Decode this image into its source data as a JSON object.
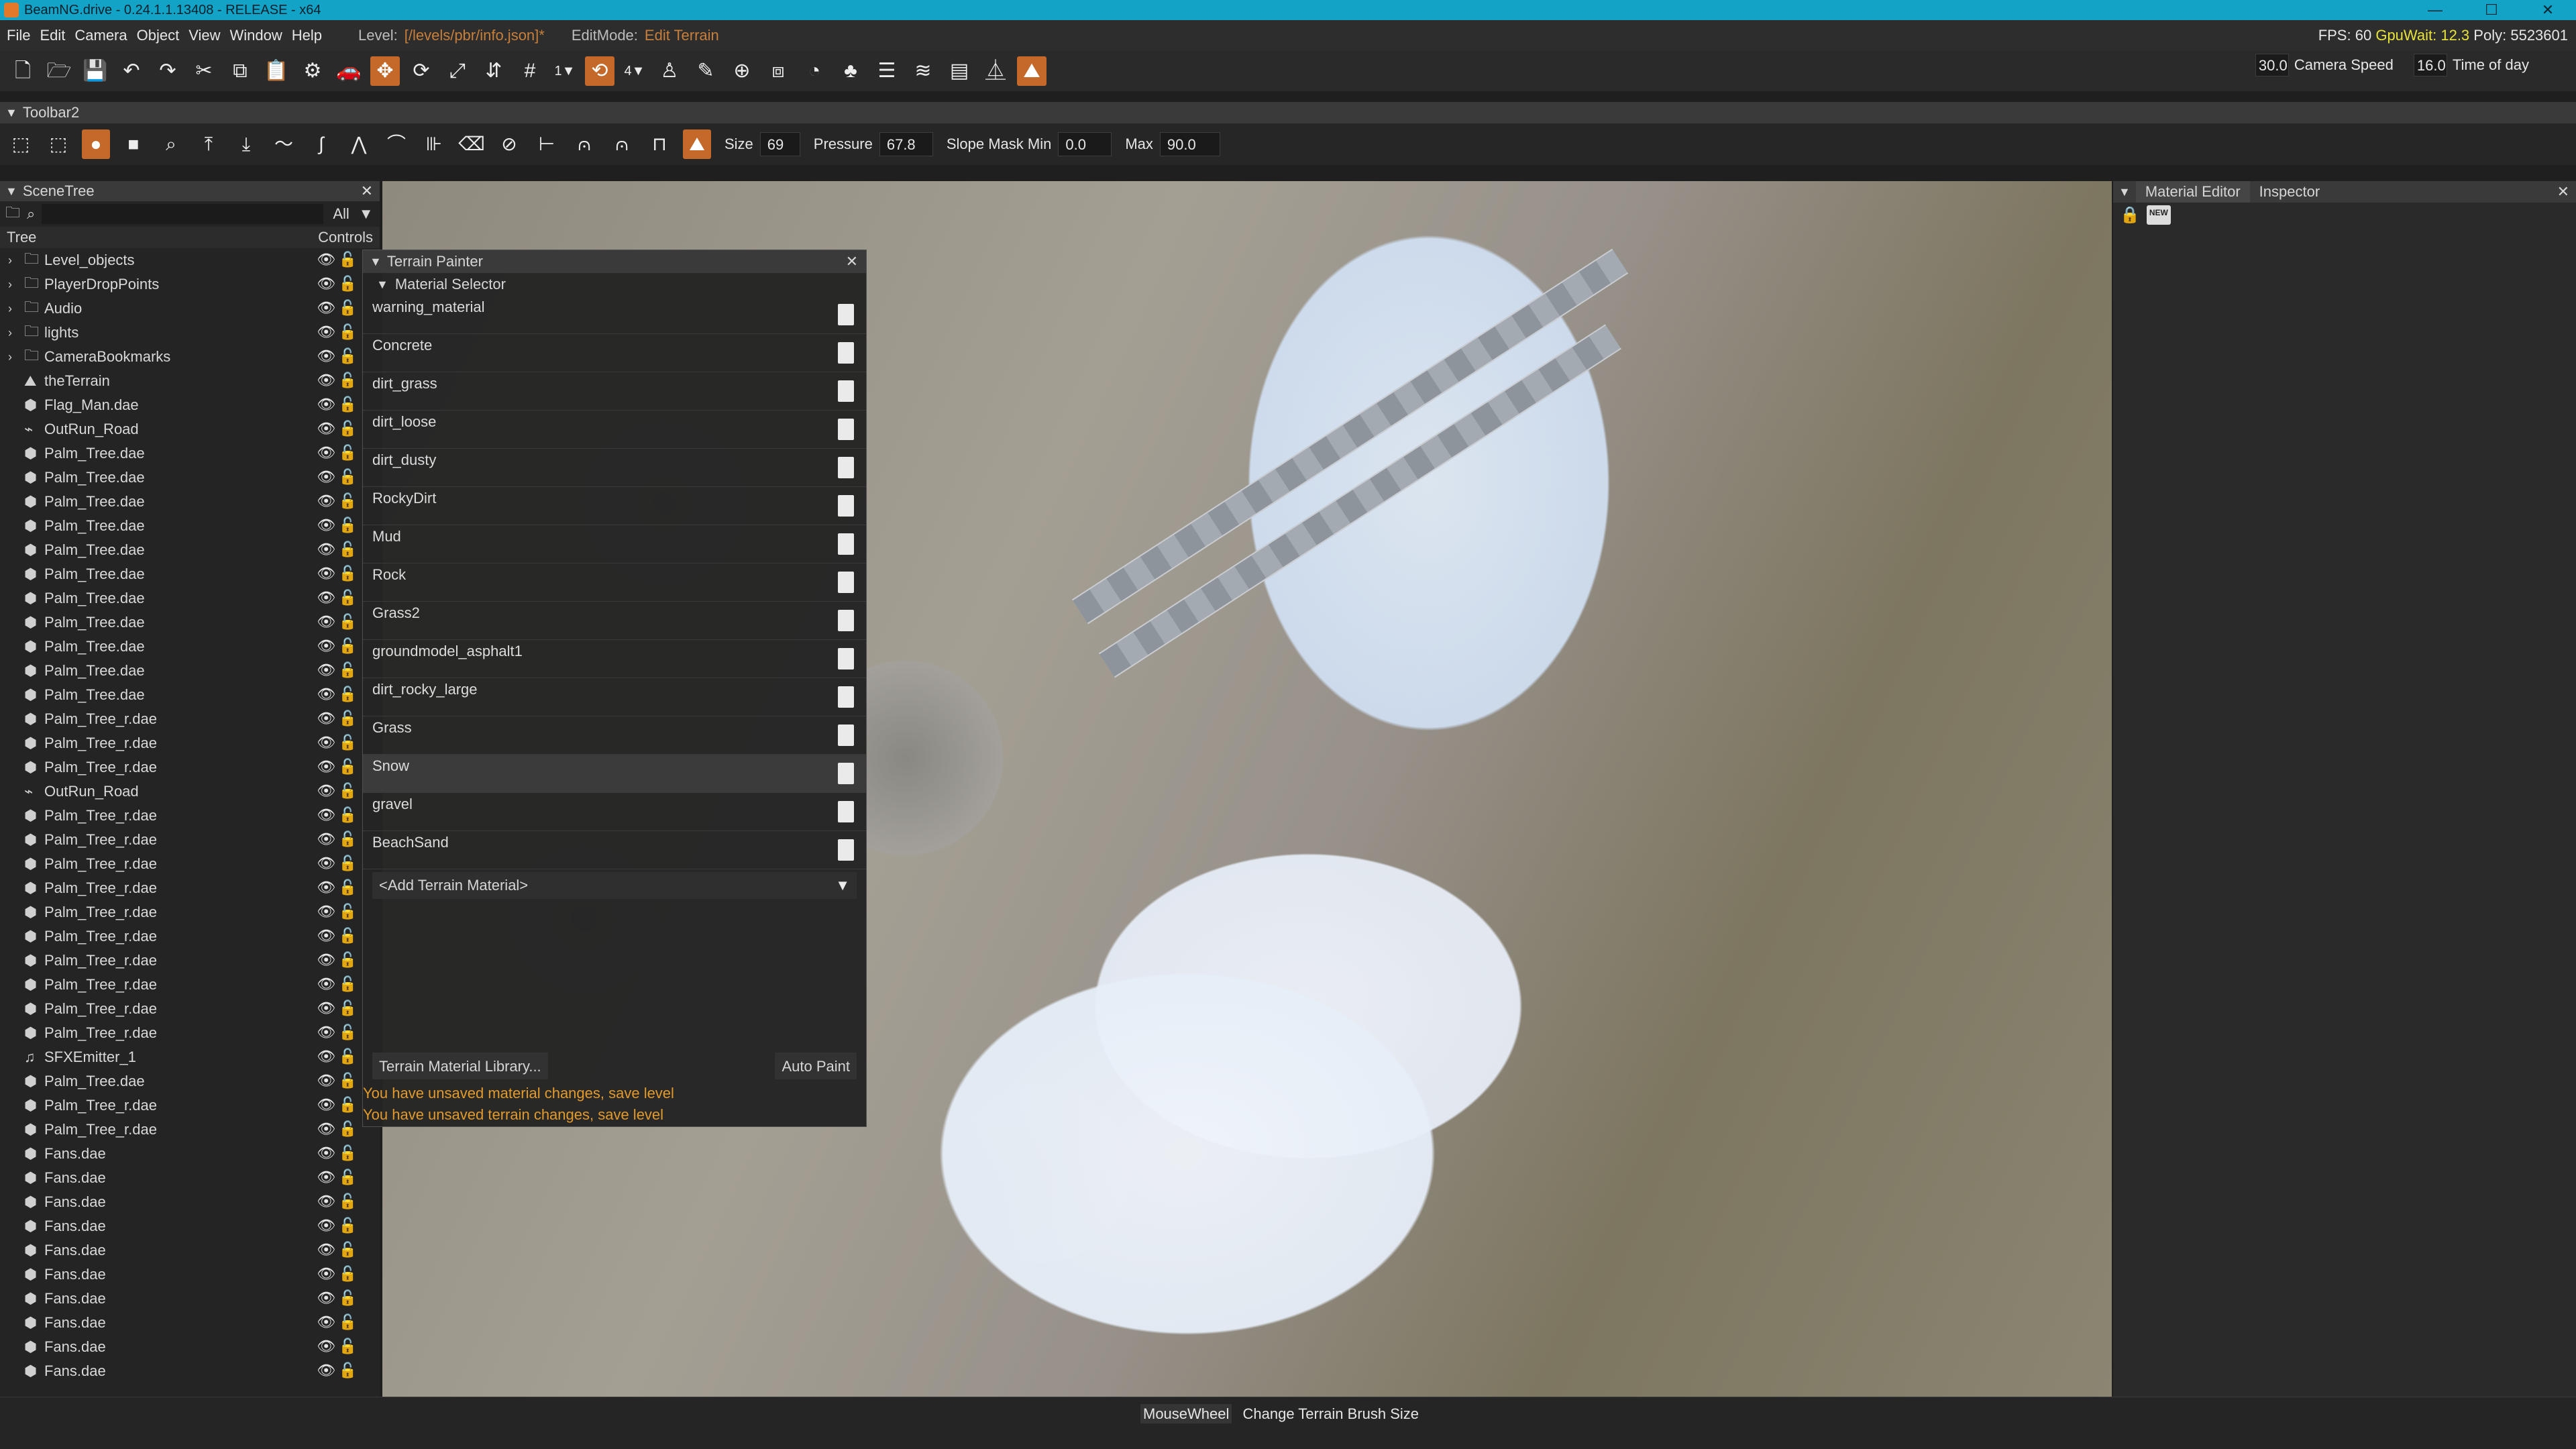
{
  "window": {
    "title": "BeamNG.drive - 0.24.1.1.13408 - RELEASE - x64",
    "controls": [
      "—",
      "☐",
      "✕"
    ]
  },
  "menu": {
    "items": [
      "File",
      "Edit",
      "Camera",
      "Object",
      "View",
      "Window",
      "Help"
    ],
    "level_label": "Level:",
    "level_path": "[/levels/pbr/info.json]*",
    "editmode_label": "EditMode:",
    "editmode_value": "Edit Terrain",
    "stats": {
      "fps_label": "FPS:",
      "fps": "60",
      "gpu_label": "GpuWait:",
      "gpu": "12.3",
      "poly_label": "Poly:",
      "poly": "5523601"
    }
  },
  "camera": {
    "speed": "30.0",
    "speed_label": "Camera Speed",
    "time": "16.0",
    "time_label": "Time of day"
  },
  "toolbar1": {
    "icons": [
      "new-file-icon",
      "open-folder-icon",
      "save-icon",
      "undo-icon",
      "redo-icon",
      "cut-icon",
      "copy-icon",
      "paste-icon",
      "settings-gear-icon",
      "vehicle-icon",
      "move-tool-icon",
      "rotate-tool-icon",
      "scale-tool-icon",
      "align-icon",
      "grid-snap-icon",
      "snap-1-icon",
      "rotate-snap-icon",
      "snap-4-icon",
      "figure-icon",
      "pencil-icon",
      "add-circle-icon",
      "camera-path-icon",
      "pie-icon",
      "forest-icon",
      "stack-icon",
      "river-icon",
      "mesh-road-icon",
      "road-icon",
      "terrain-paint-icon"
    ],
    "snap_values": [
      "1▼",
      "4▼"
    ]
  },
  "toolbar2": {
    "title": "Toolbar2",
    "size_label": "Size",
    "size_value": "69",
    "pressure_label": "Pressure",
    "pressure_value": "67.8",
    "slope_min_label": "Slope Mask Min",
    "slope_min_value": "0.0",
    "max_label": "Max",
    "max_value": "90.0"
  },
  "scenetree": {
    "title": "SceneTree",
    "filter": "All",
    "col_tree": "Tree",
    "col_controls": "Controls",
    "rows": [
      {
        "name": "Level_objects",
        "type": "folder"
      },
      {
        "name": "PlayerDropPoints",
        "type": "folder"
      },
      {
        "name": "Audio",
        "type": "folder"
      },
      {
        "name": "lights",
        "type": "folder"
      },
      {
        "name": "CameraBookmarks",
        "type": "folder"
      },
      {
        "name": "theTerrain",
        "type": "terrain"
      },
      {
        "name": "Flag_Man.dae",
        "type": "mesh"
      },
      {
        "name": "OutRun_Road",
        "type": "road"
      },
      {
        "name": "Palm_Tree.dae",
        "type": "mesh"
      },
      {
        "name": "Palm_Tree.dae",
        "type": "mesh"
      },
      {
        "name": "Palm_Tree.dae",
        "type": "mesh"
      },
      {
        "name": "Palm_Tree.dae",
        "type": "mesh"
      },
      {
        "name": "Palm_Tree.dae",
        "type": "mesh"
      },
      {
        "name": "Palm_Tree.dae",
        "type": "mesh"
      },
      {
        "name": "Palm_Tree.dae",
        "type": "mesh"
      },
      {
        "name": "Palm_Tree.dae",
        "type": "mesh"
      },
      {
        "name": "Palm_Tree.dae",
        "type": "mesh"
      },
      {
        "name": "Palm_Tree.dae",
        "type": "mesh"
      },
      {
        "name": "Palm_Tree.dae",
        "type": "mesh"
      },
      {
        "name": "Palm_Tree_r.dae",
        "type": "mesh"
      },
      {
        "name": "Palm_Tree_r.dae",
        "type": "mesh"
      },
      {
        "name": "Palm_Tree_r.dae",
        "type": "mesh"
      },
      {
        "name": "OutRun_Road",
        "type": "road"
      },
      {
        "name": "Palm_Tree_r.dae",
        "type": "mesh"
      },
      {
        "name": "Palm_Tree_r.dae",
        "type": "mesh"
      },
      {
        "name": "Palm_Tree_r.dae",
        "type": "mesh"
      },
      {
        "name": "Palm_Tree_r.dae",
        "type": "mesh"
      },
      {
        "name": "Palm_Tree_r.dae",
        "type": "mesh"
      },
      {
        "name": "Palm_Tree_r.dae",
        "type": "mesh"
      },
      {
        "name": "Palm_Tree_r.dae",
        "type": "mesh"
      },
      {
        "name": "Palm_Tree_r.dae",
        "type": "mesh"
      },
      {
        "name": "Palm_Tree_r.dae",
        "type": "mesh"
      },
      {
        "name": "Palm_Tree_r.dae",
        "type": "mesh"
      },
      {
        "name": "SFXEmitter_1",
        "type": "sound"
      },
      {
        "name": "Palm_Tree.dae",
        "type": "mesh"
      },
      {
        "name": "Palm_Tree_r.dae",
        "type": "mesh"
      },
      {
        "name": "Palm_Tree_r.dae",
        "type": "mesh"
      },
      {
        "name": "Fans.dae",
        "type": "mesh"
      },
      {
        "name": "Fans.dae",
        "type": "mesh"
      },
      {
        "name": "Fans.dae",
        "type": "mesh"
      },
      {
        "name": "Fans.dae",
        "type": "mesh"
      },
      {
        "name": "Fans.dae",
        "type": "mesh"
      },
      {
        "name": "Fans.dae",
        "type": "mesh"
      },
      {
        "name": "Fans.dae",
        "type": "mesh"
      },
      {
        "name": "Fans.dae",
        "type": "mesh"
      },
      {
        "name": "Fans.dae",
        "type": "mesh"
      },
      {
        "name": "Fans.dae",
        "type": "mesh"
      }
    ]
  },
  "terrain_painter": {
    "title": "Terrain Painter",
    "section": "Material Selector",
    "materials": [
      "warning_material",
      "Concrete",
      "dirt_grass",
      "dirt_loose",
      "dirt_dusty",
      "RockyDirt",
      "Mud",
      "Rock",
      "Grass2",
      "groundmodel_asphalt1",
      "dirt_rocky_large",
      "Grass",
      "Snow",
      "gravel",
      "BeachSand"
    ],
    "selected": "Snow",
    "add_material": "<Add Terrain Material>",
    "library_button": "Terrain Material Library...",
    "auto_paint_button": "Auto Paint",
    "warning_material": "You have unsaved material changes, save level",
    "warning_terrain": "You have unsaved terrain changes, save level"
  },
  "rightpanel": {
    "tab_material": "Material Editor",
    "tab_inspector": "Inspector",
    "new_label": "NEW"
  },
  "status": {
    "key": "MouseWheel",
    "action": "Change Terrain Brush Size"
  },
  "colors": {
    "titlebar": "#12a3c7",
    "accent": "#c4692a",
    "warning": "#e39a2a",
    "gpu": "#e8e23a"
  }
}
